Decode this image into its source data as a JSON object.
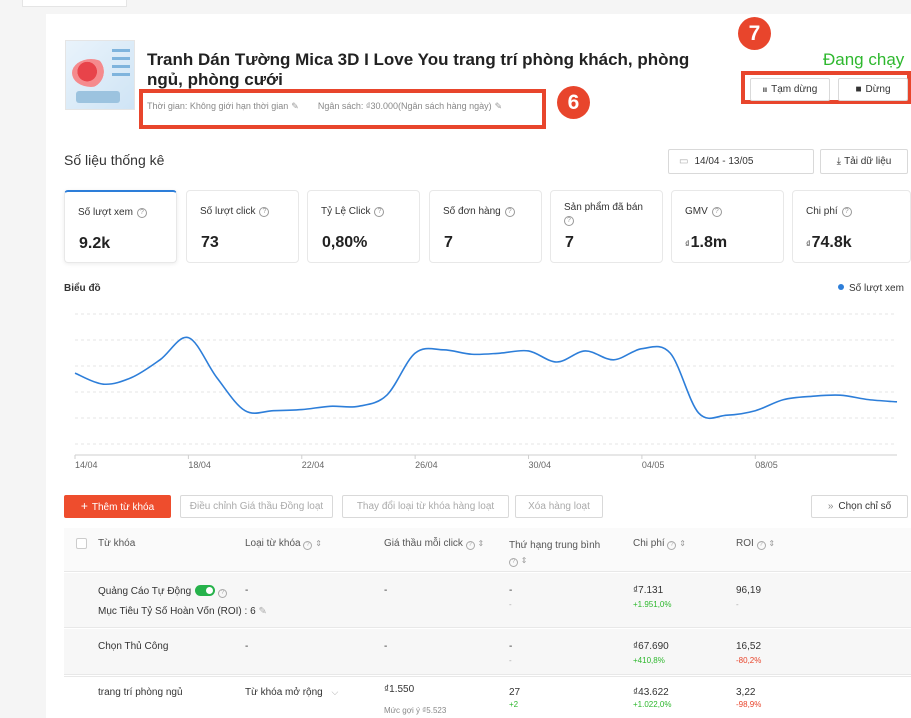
{
  "product": {
    "title": "Tranh Dán Tường Mica 3D I Love You trang trí phòng khách, phòng ngủ, phòng cưới",
    "time_label": "Thời gian: Không giới hạn thời gian",
    "budget_label": "Ngân sách: ₫30.000(Ngân sách hàng ngày)",
    "status": "Đang chạy"
  },
  "annotations": {
    "six": "6",
    "seven": "7"
  },
  "actions": {
    "pause": "Tạm dừng",
    "stop": "Dừng",
    "pause_icon": "ıı",
    "stop_icon": "■"
  },
  "stats": {
    "title": "Số liệu thống kê",
    "date_range": "14/04 - 13/05",
    "download": "Tải dữ liệu",
    "cards": [
      {
        "label": "Số lượt xem",
        "value": "9.2k",
        "currency": ""
      },
      {
        "label": "Số lượt click",
        "value": "73",
        "currency": ""
      },
      {
        "label": "Tỷ Lệ Click",
        "value": "0,80%",
        "currency": ""
      },
      {
        "label": "Số đơn hàng",
        "value": "7",
        "currency": ""
      },
      {
        "label": "Sản phẩm đã bán",
        "value": "7",
        "currency": ""
      },
      {
        "label": "GMV",
        "value": "1.8m",
        "currency": "₫"
      },
      {
        "label": "Chi phí",
        "value": "74.8k",
        "currency": "₫"
      }
    ]
  },
  "chart_data": {
    "type": "line",
    "title": "Biểu đồ",
    "legend": "Số lượt xem",
    "legend_position": "top-right",
    "grid": true,
    "color": "#2d7ed9",
    "x": [
      "14/04",
      "15/04",
      "16/04",
      "17/04",
      "18/04",
      "19/04",
      "20/04",
      "21/04",
      "22/04",
      "23/04",
      "24/04",
      "25/04",
      "26/04",
      "27/04",
      "28/04",
      "29/04",
      "30/04",
      "01/05",
      "02/05",
      "03/05",
      "04/05",
      "05/05",
      "06/05",
      "07/05",
      "08/05",
      "09/05",
      "10/05",
      "11/05",
      "12/05",
      "13/05"
    ],
    "xticks": [
      "14/04",
      "18/04",
      "22/04",
      "26/04",
      "30/04",
      "04/05",
      "08/05"
    ],
    "values": [
      370,
      320,
      350,
      430,
      530,
      350,
      200,
      200,
      205,
      220,
      220,
      270,
      460,
      475,
      455,
      460,
      470,
      420,
      470,
      430,
      480,
      460,
      190,
      180,
      200,
      250,
      265,
      270,
      250,
      240
    ],
    "ylim": [
      0,
      700
    ]
  },
  "toolbar": {
    "add_keyword": "Thêm từ khóa",
    "add_icon": "+",
    "bulk_bid": "Điều chỉnh Giá thầu Đồng loạt",
    "change_type": "Thay đổi loại từ khóa hàng loạt",
    "bulk_delete": "Xóa hàng loạt",
    "choose_metrics": "Chọn chỉ số"
  },
  "table": {
    "headers": {
      "keyword": "Từ khóa",
      "type": "Loại từ khóa",
      "bid": "Giá thầu mỗi click",
      "rank": "Thứ hạng trung bình",
      "cost": "Chi phí",
      "roi": "ROI"
    },
    "rows": [
      {
        "keyword": "Quảng Cáo Tự Động",
        "keyword_line2": "Mục Tiêu Tỷ Số Hoàn Vốn (ROI) :  6",
        "type": "-",
        "bid": "-",
        "rank": "-",
        "rank_sub": "-",
        "cost": "₫7.131",
        "cost_change": "+1.951,0%",
        "roi": "96,19",
        "roi_change": "-"
      },
      {
        "keyword": "Chọn Thủ Công",
        "type": "-",
        "bid": "-",
        "rank": "-",
        "rank_sub": "-",
        "cost": "₫67.690",
        "cost_change": "+410,8%",
        "roi": "16,52",
        "roi_change": "-80,2%"
      },
      {
        "keyword": "trang trí phòng ngủ",
        "type": "Từ khóa mở rộng",
        "bid": "₫1.550",
        "bid_sub": "Mức gợi ý ₫5.523",
        "rank": "27",
        "rank_sub": "+2",
        "cost": "₫43.622",
        "cost_change": "+1.022,0%",
        "roi": "3,22",
        "roi_change": "-98,9%"
      }
    ]
  }
}
